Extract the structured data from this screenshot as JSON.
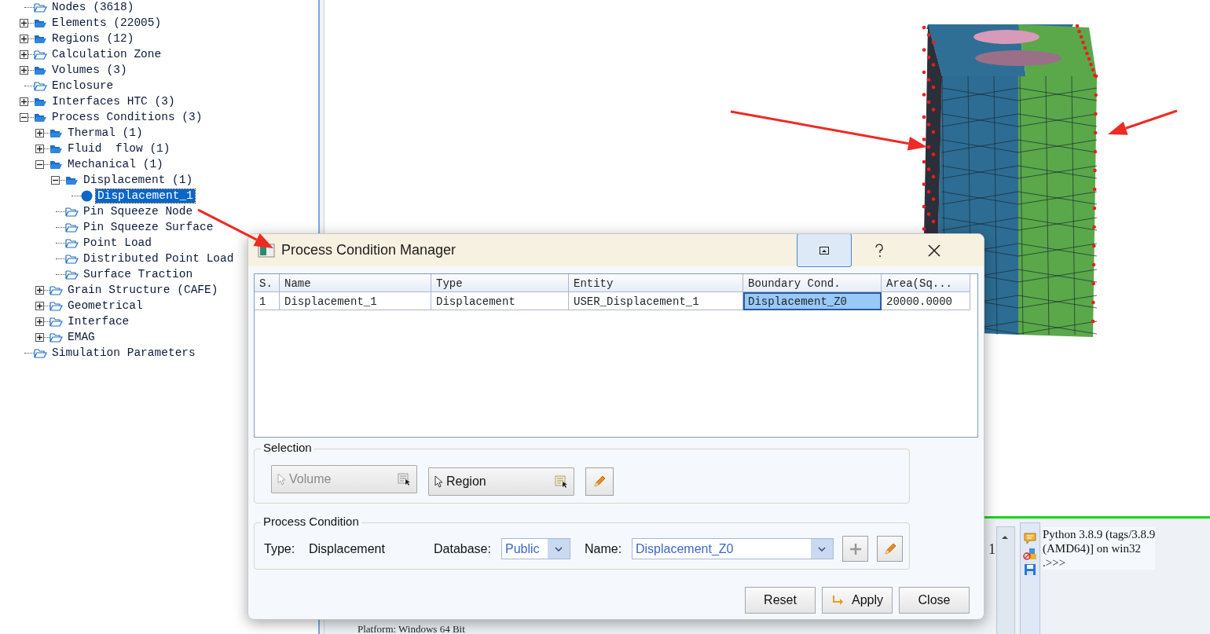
{
  "tree": [
    {
      "label": "Nodes (3618)",
      "kind": "folder-outline",
      "expandable": false,
      "expanded": false,
      "selected": false
    },
    {
      "label": "Elements (22005)",
      "kind": "folder-filled",
      "expandable": true,
      "expanded": false,
      "selected": false
    },
    {
      "label": "Regions (12)",
      "kind": "folder-filled",
      "expandable": true,
      "expanded": false,
      "selected": false
    },
    {
      "label": "Calculation Zone",
      "kind": "folder-outline",
      "expandable": true,
      "expanded": false,
      "selected": false
    },
    {
      "label": "Volumes (3)",
      "kind": "folder-filled",
      "expandable": true,
      "expanded": false,
      "selected": false
    },
    {
      "label": "Enclosure",
      "kind": "folder-outline",
      "expandable": false,
      "expanded": false,
      "selected": false
    },
    {
      "label": "Interfaces HTC (3)",
      "kind": "folder-filled",
      "expandable": true,
      "expanded": false,
      "selected": false
    },
    {
      "label": "Process Conditions (3)",
      "kind": "folder-filled",
      "expandable": true,
      "expanded": true,
      "selected": false,
      "children": [
        {
          "label": "Thermal (1)",
          "kind": "folder-filled",
          "expandable": true,
          "expanded": false,
          "selected": false
        },
        {
          "label": "Fluid  flow (1)",
          "kind": "folder-filled",
          "expandable": true,
          "expanded": false,
          "selected": false
        },
        {
          "label": "Mechanical (1)",
          "kind": "folder-filled",
          "expandable": true,
          "expanded": true,
          "selected": false,
          "children": [
            {
              "label": "Displacement (1)",
              "kind": "folder-filled",
              "expandable": true,
              "expanded": true,
              "selected": false,
              "children": [
                {
                  "label": "Displacement_1",
                  "kind": "dot",
                  "expandable": false,
                  "expanded": false,
                  "selected": true
                }
              ]
            },
            {
              "label": "Pin Squeeze Node",
              "kind": "folder-outline",
              "expandable": false,
              "expanded": false,
              "selected": false
            },
            {
              "label": "Pin Squeeze Surface",
              "kind": "folder-outline",
              "expandable": false,
              "expanded": false,
              "selected": false
            },
            {
              "label": "Point Load",
              "kind": "folder-outline",
              "expandable": false,
              "expanded": false,
              "selected": false
            },
            {
              "label": "Distributed Point Load",
              "kind": "folder-outline",
              "expandable": false,
              "expanded": false,
              "selected": false
            },
            {
              "label": "Surface Traction",
              "kind": "folder-outline",
              "expandable": false,
              "expanded": false,
              "selected": false
            }
          ]
        },
        {
          "label": "Grain Structure (CAFE)",
          "kind": "folder-outline",
          "expandable": true,
          "expanded": false,
          "selected": false
        },
        {
          "label": "Geometrical",
          "kind": "folder-outline",
          "expandable": true,
          "expanded": false,
          "selected": false
        },
        {
          "label": "Interface",
          "kind": "folder-outline",
          "expandable": true,
          "expanded": false,
          "selected": false
        },
        {
          "label": "EMAG",
          "kind": "folder-outline",
          "expandable": true,
          "expanded": false,
          "selected": false
        }
      ]
    },
    {
      "label": "Simulation Parameters",
      "kind": "folder-outline",
      "expandable": false,
      "expanded": false,
      "selected": false
    }
  ],
  "console": {
    "lines": [
      "Python 3.8.9 (tags/3.8.9",
      "(AMD64)] on win32",
      ".>>>"
    ],
    "gutter_text": "1",
    "output_text": "Platform: Windows 64 Bit"
  },
  "dialog": {
    "title": "Process Condition Manager",
    "table": {
      "columns": [
        "S.",
        "Name",
        "Type",
        "Entity",
        "Boundary Cond.",
        "Area(Sq..."
      ],
      "rows": [
        {
          "cells": [
            {
              "text": "1",
              "selected": false
            },
            {
              "text": "Displacement_1",
              "selected": false
            },
            {
              "text": "Displacement",
              "selected": false
            },
            {
              "text": "USER_Displacement_1",
              "selected": false
            },
            {
              "text": "Displacement_Z0",
              "selected": true
            },
            {
              "text": "20000.0000",
              "selected": false
            }
          ]
        }
      ]
    },
    "selection": {
      "title": "Selection",
      "buttons": [
        {
          "label": "Volume",
          "disabled": true
        },
        {
          "label": "Region",
          "disabled": false
        }
      ]
    },
    "process_condition": {
      "title": "Process Condition",
      "type_label": "Type:",
      "type_value": "Displacement",
      "database_label": "Database:",
      "database_value": "Public",
      "name_label": "Name:",
      "name_value": "Displacement_Z0"
    },
    "buttons": [
      "Reset",
      "Apply",
      "Close"
    ]
  }
}
